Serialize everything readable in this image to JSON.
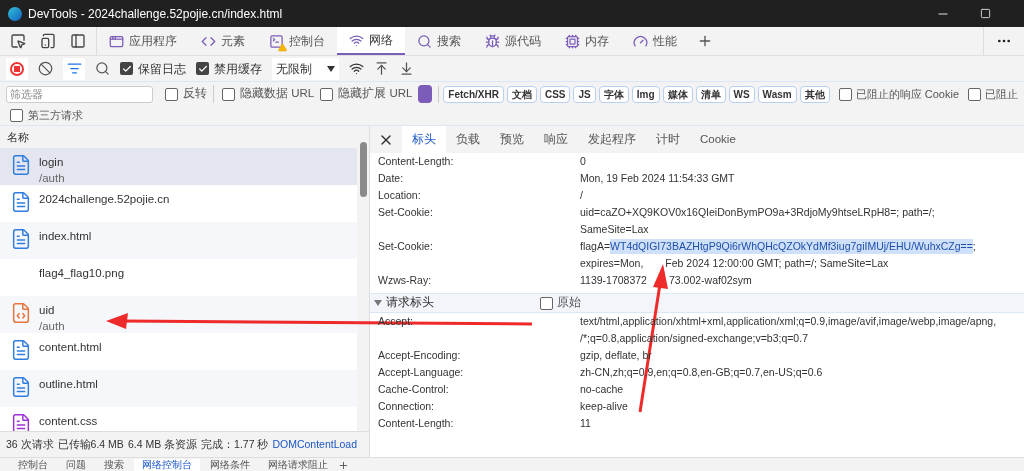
{
  "window": {
    "title": "DevTools - 2024challenge.52pojie.cn/index.html"
  },
  "tabs": [
    {
      "label": "应用程序",
      "kind": "app",
      "selected": false,
      "warning": false
    },
    {
      "label": "元素",
      "kind": "code",
      "selected": false,
      "warning": false
    },
    {
      "label": "控制台",
      "kind": "console",
      "selected": false,
      "warning": true
    },
    {
      "label": "网络",
      "kind": "wifi",
      "selected": true,
      "warning": false
    },
    {
      "label": "搜索",
      "kind": "search",
      "selected": false,
      "warning": false
    },
    {
      "label": "源代码",
      "kind": "bug",
      "selected": false,
      "warning": false
    },
    {
      "label": "内存",
      "kind": "chip",
      "selected": false,
      "warning": false
    },
    {
      "label": "性能",
      "kind": "gauge",
      "selected": false,
      "warning": false
    }
  ],
  "toolbar": {
    "recording": true,
    "filter_open": true,
    "checks": [
      {
        "label": "保留日志",
        "checked": true
      },
      {
        "label": "禁用缓存",
        "checked": true
      }
    ],
    "throttle": "无限制"
  },
  "filter": {
    "placeholder": "筛选器",
    "checks": [
      {
        "label": "反转",
        "checked": false
      },
      {
        "label": "隐藏数据 URL",
        "checked": false
      },
      {
        "label": "隐藏扩展 URL",
        "checked": false
      }
    ],
    "all_chip": {
      "selected": true
    },
    "chips": [
      {
        "label": "Fetch/XHR",
        "selected": false
      },
      {
        "label": "文档",
        "selected": false
      },
      {
        "label": "CSS",
        "selected": false
      },
      {
        "label": "JS",
        "selected": false
      },
      {
        "label": "字体",
        "selected": false
      },
      {
        "label": "Img",
        "selected": false
      },
      {
        "label": "媒体",
        "selected": false
      },
      {
        "label": "清单",
        "selected": false
      },
      {
        "label": "WS",
        "selected": false
      },
      {
        "label": "Wasm",
        "selected": false
      },
      {
        "label": "其他",
        "selected": false
      }
    ],
    "right_checks": [
      {
        "label": "已阻止的响应 Cookie",
        "checked": false
      },
      {
        "label": "已阻止",
        "checked": false
      }
    ],
    "third_party": {
      "label": "第三方请求",
      "checked": false
    }
  },
  "requests": {
    "column": "名称",
    "items": [
      {
        "name": "login",
        "path": "/auth",
        "kind": "document",
        "selected": true
      },
      {
        "name": "2024challenge.52pojie.cn",
        "kind": "document",
        "selected": false
      },
      {
        "name": "index.html",
        "kind": "document",
        "selected": false
      },
      {
        "name": "flag4_flag10.png",
        "kind": "image",
        "selected": false
      },
      {
        "name": "uid",
        "path": "/auth",
        "kind": "script",
        "selected": false
      },
      {
        "name": "content.html",
        "kind": "document",
        "selected": false
      },
      {
        "name": "outline.html",
        "kind": "document",
        "selected": false
      },
      {
        "name": "content.css",
        "kind": "stylesheet",
        "selected": false
      }
    ]
  },
  "status_bar": [
    "36 次请求",
    "已传输6.4 MB",
    "6.4 MB 条资源",
    "完成：1.77 秒",
    "DOMContentLoad"
  ],
  "details": {
    "tabs": [
      {
        "label": "标头",
        "selected": true
      },
      {
        "label": "负载",
        "selected": false
      },
      {
        "label": "预览",
        "selected": false
      },
      {
        "label": "响应",
        "selected": false
      },
      {
        "label": "发起程序",
        "selected": false
      },
      {
        "label": "计时",
        "selected": false
      },
      {
        "label": "Cookie",
        "selected": false
      }
    ],
    "response_headers": [
      {
        "name": "Content-Length:",
        "lines": [
          [
            {
              "text": "0",
              "selected": false
            }
          ]
        ]
      },
      {
        "name": "Date:",
        "lines": [
          [
            {
              "text": "Mon, 19 Feb 2024 11:54:33 GMT",
              "selected": false
            }
          ]
        ]
      },
      {
        "name": "Location:",
        "lines": [
          [
            {
              "text": "/",
              "selected": false
            }
          ]
        ]
      },
      {
        "name": "Set-Cookie:",
        "lines": [
          [
            {
              "text": "uid=caZO+XQ9KOV0x16QIeiDonBymPO9a+3RdjoMy9htseLRpH8=; path=/;",
              "selected": false
            }
          ],
          [
            {
              "text": "SameSite=Lax",
              "selected": false
            }
          ]
        ]
      },
      {
        "name": "Set-Cookie:",
        "lines": [
          [
            {
              "text": "flagA=",
              "selected": false
            },
            {
              "text": "WT4dQIGI73BAZHtgP9Qi6rWhQHcQZOkYdMf3iug7giIMUj/EHU/WuhxCZg==",
              "selected": true
            },
            {
              "text": ";",
              "selected": false
            }
          ],
          [
            {
              "text": "expires=Mon,",
              "selected": false
            },
            {
              "text": "Feb 2024 12:00:00 GMT; path=/; SameSite=Lax",
              "selected": false
            }
          ]
        ]
      },
      {
        "name": "Wzws-Ray:",
        "lines": [
          [
            {
              "text": "1139-1708372",
              "selected": false
            },
            {
              "text": "73.002-waf02sym",
              "selected": false
            }
          ]
        ]
      }
    ],
    "request_section": {
      "title": "请求标头",
      "expanded": true,
      "raw": {
        "label": "原始",
        "checked": false
      }
    },
    "request_headers": [
      {
        "name": "Accept:",
        "lines": [
          [
            {
              "text": "text/html,application/xhtml+xml,application/xml;q=0.9,image/avif,image/webp,image/apng,",
              "selected": false
            }
          ],
          [
            {
              "text": "/*;q=0.8,application/signed-exchange;v=b3;q=0.7",
              "selected": false
            }
          ]
        ]
      },
      {
        "name": "Accept-Encoding:",
        "lines": [
          [
            {
              "text": "gzip, deflate, br",
              "selected": false
            }
          ]
        ]
      },
      {
        "name": "Accept-Language:",
        "lines": [
          [
            {
              "text": "zh-CN,zh;q=0.9,en;q=0.8,en-GB;q=0.7,en-US;q=0.6",
              "selected": false
            }
          ]
        ]
      },
      {
        "name": "Cache-Control:",
        "lines": [
          [
            {
              "text": "no-cache",
              "selected": false
            }
          ]
        ]
      },
      {
        "name": "Connection:",
        "lines": [
          [
            {
              "text": "keep-alive",
              "selected": false
            }
          ]
        ]
      },
      {
        "name": "Content-Length:",
        "lines": [
          [
            {
              "text": "11",
              "selected": false
            }
          ]
        ]
      }
    ]
  },
  "drawer_tabs": [
    {
      "label": "控制台",
      "selected": false
    },
    {
      "label": "问题",
      "selected": false
    },
    {
      "label": "搜索",
      "selected": false
    },
    {
      "label": "网络控制台",
      "selected": true
    },
    {
      "label": "网络条件",
      "selected": false
    },
    {
      "label": "网络请求阻止",
      "selected": false
    }
  ]
}
